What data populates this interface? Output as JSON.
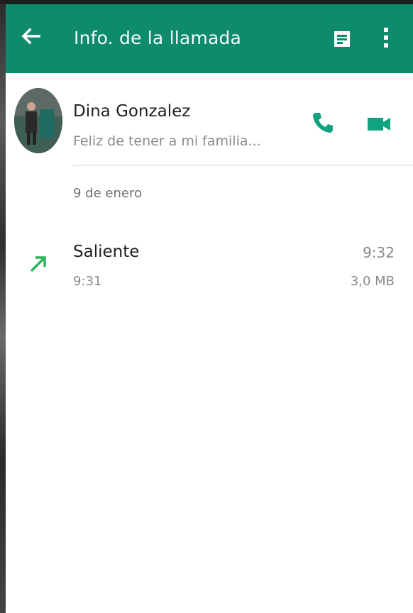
{
  "appbar": {
    "title": "Info. de la llamada",
    "back_icon": "arrow-left-icon",
    "actions": [
      "message-icon",
      "more-vert-icon"
    ],
    "color": "#0e8a6d"
  },
  "contact": {
    "name": "Dina Gonzalez",
    "status": "Feliz de tener a mi familia...",
    "actions": [
      "phone-icon",
      "videocam-icon"
    ],
    "action_color": "#10a37f"
  },
  "call_log": {
    "date": "9 de enero",
    "entries": [
      {
        "type": "Saliente",
        "direction_icon": "outgoing-arrow-icon",
        "start_time": "9:31",
        "duration": "9:32",
        "size": "3,0 MB"
      }
    ]
  }
}
